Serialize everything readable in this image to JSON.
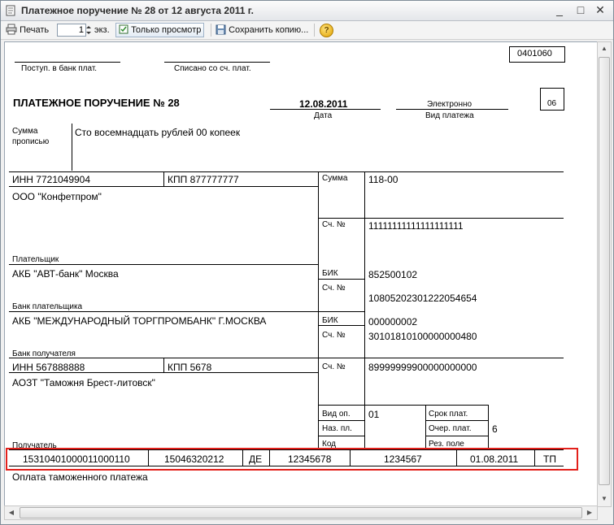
{
  "window": {
    "title": "Платежное поручение № 28 от 12 августа 2011 г.",
    "minimize_glyph": "_",
    "maximize_glyph": "□",
    "close_glyph": "✕"
  },
  "toolbar": {
    "print_label": "Печать",
    "copies_value": "1",
    "copies_unit": "экз.",
    "view_only_label": "Только просмотр",
    "save_copy_label": "Сохранить копию...",
    "help_glyph": "?"
  },
  "icons": [
    "document-icon",
    "printer-icon",
    "spinner-icon",
    "view-only-icon",
    "floppy-icon",
    "help-icon"
  ],
  "colors": {
    "highlight_border": "#e3201b"
  },
  "form": {
    "okud_code": "0401060",
    "bank_received_label": "Поступ. в банк плат.",
    "debited_label": "Списано со сч. плат.",
    "heading": "ПЛАТЕЖНОЕ ПОРУЧЕНИЕ № 28",
    "date_value": "12.08.2011",
    "date_label": "Дата",
    "payment_type_value": "Электронно",
    "payment_type_label": "Вид платежа",
    "status_code": "06",
    "amount_words_label_1": "Сумма",
    "amount_words_label_2": "прописью",
    "amount_words_value": "Сто восемнадцать рублей 00 копеек",
    "payer_inn": "ИНН 7721049904",
    "payer_kpp": "КПП 877777777",
    "payer_name": "ООО \"Конфетпром\"",
    "payer_label": "Плательщик",
    "amount_label": "Сумма",
    "amount_value": "118-00",
    "payer_account_label": "Сч. №",
    "payer_account_value": "11111111111111111111",
    "payer_bank_name": "АКБ \"АВТ-банк\" Москва",
    "payer_bank_label": "Банк плательщика",
    "payer_bik_label": "БИК",
    "payer_bik_value": "852500102",
    "payer_corr_label": "Сч. №",
    "payer_corr_value": "10805202301222054654",
    "payee_bank_name": "АКБ \"МЕЖДУНАРОДНЫЙ ТОРГПРОМБАНК\" Г.МОСКВА",
    "payee_bank_label": "Банк получателя",
    "payee_bik_label": "БИК",
    "payee_bik_value": "000000002",
    "payee_corr_label": "Сч. №",
    "payee_corr_value": "30101810100000000480",
    "payee_inn": "ИНН 567888888",
    "payee_kpp": "КПП 5678",
    "payee_name": "АОЗТ \"Таможня Брест-литовск\"",
    "payee_label": "Получатель",
    "payee_account_label": "Сч. №",
    "payee_account_value": "89999999900000000000",
    "op_type_label": "Вид оп.",
    "op_type_value": "01",
    "purpose_label": "Наз. пл.",
    "code_label": "Код",
    "term_label": "Срок плат.",
    "order_label": "Очер. плат.",
    "order_value": "6",
    "reserve_label": "Рез. поле",
    "tax_fields": [
      "15310401000011000110",
      "15046320212",
      "ДЕ",
      "12345678",
      "1234567",
      "01.08.2011",
      "ТП"
    ],
    "payment_purpose": "Оплата таможенного платежа"
  }
}
